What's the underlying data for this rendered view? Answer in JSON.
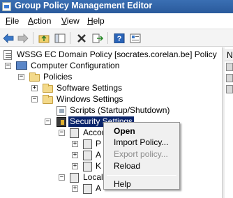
{
  "window": {
    "title": "Group Policy Management Editor"
  },
  "menu": [
    {
      "label": "File",
      "underline": "F",
      "rest": "ile"
    },
    {
      "label": "Action",
      "underline": "A",
      "rest": "ction"
    },
    {
      "label": "View",
      "underline": "V",
      "rest": "iew"
    },
    {
      "label": "Help",
      "underline": "H",
      "rest": "elp"
    }
  ],
  "toolbar": {
    "buttons": [
      "back-icon",
      "forward-icon",
      "up-folder-icon",
      "show-hide-tree-icon",
      "delete-icon",
      "export-list-icon",
      "help-icon",
      "properties-icon"
    ]
  },
  "tree": {
    "root": "WSSG EC Domain Policy [socrates.corelan.be] Policy",
    "computer_configuration": "Computer Configuration",
    "policies": "Policies",
    "software_settings": "Software Settings",
    "windows_settings": "Windows Settings",
    "scripts": "Scripts (Startup/Shutdown)",
    "security_settings": "Security Settings",
    "account": "Accou",
    "account_child_1": "P",
    "account_child_2": "A",
    "account_child_3": "K",
    "local": "Local",
    "local_child_1": "A"
  },
  "context_menu": {
    "open": "Open",
    "import_policy": "Import Policy...",
    "export_policy": "Export policy...",
    "reload": "Reload",
    "help": "Help"
  },
  "right_pane": {
    "header": "Na"
  }
}
